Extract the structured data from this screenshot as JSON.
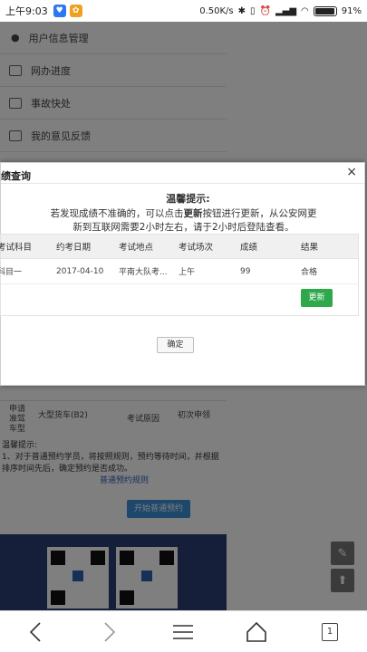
{
  "status_bar": {
    "time": "上午9:03",
    "net_speed": "0.50K/s",
    "battery": "91%"
  },
  "menu": [
    {
      "label": "用户信息管理"
    },
    {
      "label": "网办进度"
    },
    {
      "label": "事故快处"
    },
    {
      "label": "我的意见反馈"
    }
  ],
  "background": {
    "row_label_1": "申请准驾车型",
    "row_value_1": "大型货车(B2)",
    "row_label_2": "考试原因",
    "row_value_2": "初次申领",
    "tip_title": "温馨提示:",
    "tip_text": "1、对于普通预约学员，将按照规则，预约等待时间，并根据排序时间先后，确定预约是否成功。",
    "tip_link": "普通预约规则",
    "start_button": "开始普通预约"
  },
  "modal": {
    "title": "绩查询",
    "close_label": "×",
    "tip_title": "温馨提示:",
    "tip_line1_pre": "若发现成绩不准确的，可以点击",
    "tip_line1_bold": "更新",
    "tip_line1_post": "按钮进行更新，从公安网更",
    "tip_line2": "新到互联网需要2小时左右，请于2小时后登陆查看。",
    "columns": [
      "考试科目",
      "约考日期",
      "考试地点",
      "考试场次",
      "成绩",
      "结果"
    ],
    "rows": [
      [
        "科目一",
        "2017-04-10",
        "平南大队考...",
        "上午",
        "99",
        "合格"
      ]
    ],
    "update_button": "更新",
    "confirm_button": "确定"
  },
  "navbar": {
    "tab_count": "1"
  }
}
